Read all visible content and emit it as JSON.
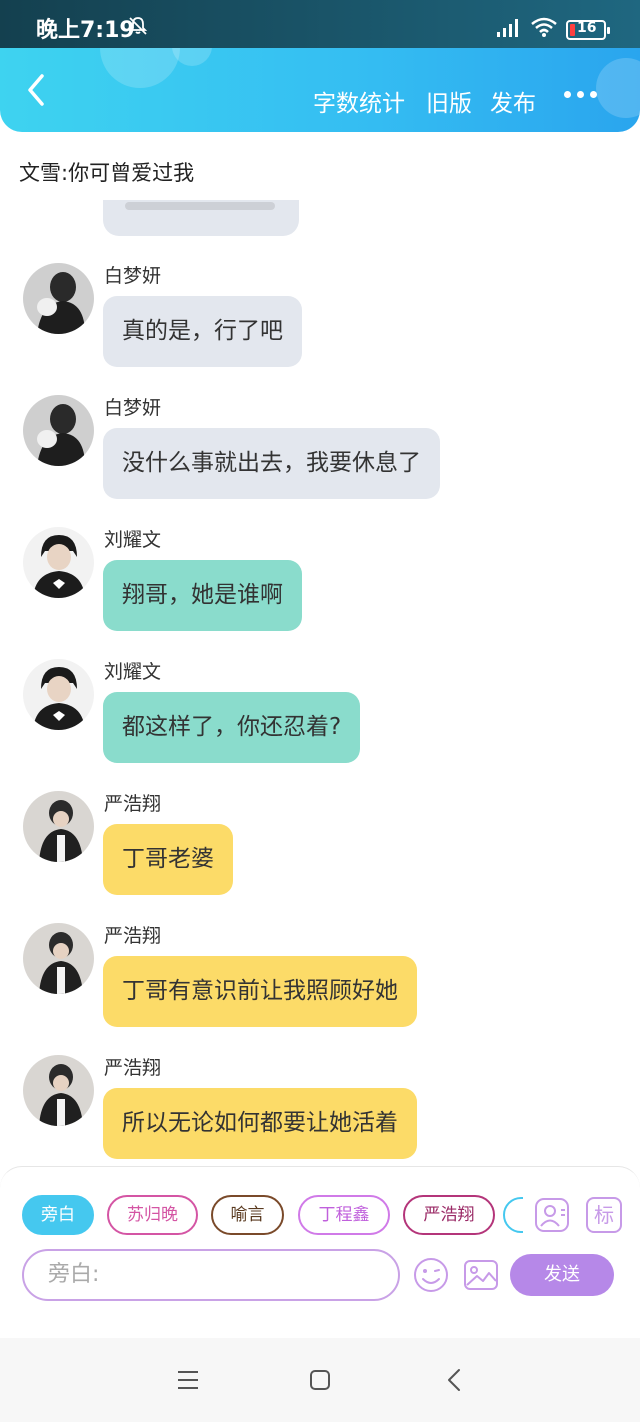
{
  "status_bar": {
    "time": "晚上7:19",
    "battery": "16",
    "icons": [
      "bell-off-icon",
      "signal-icon",
      "wifi-icon",
      "battery-icon"
    ]
  },
  "header": {
    "back_icon": "chevron-left-icon",
    "word_count": "字数统计",
    "old_version": "旧版",
    "publish": "发布",
    "more_icon": "more-dots-icon"
  },
  "subtitle": "文雪:你可曾爱过我",
  "messages": [
    {
      "sender": "白梦妍",
      "text": "真的是，行了吧",
      "style": "grey"
    },
    {
      "sender": "白梦妍",
      "text": "没什么事就出去，我要休息了",
      "style": "grey"
    },
    {
      "sender": "刘耀文",
      "text": "翔哥，她是谁啊",
      "style": "teal"
    },
    {
      "sender": "刘耀文",
      "text": "都这样了，你还忍着?",
      "style": "teal"
    },
    {
      "sender": "严浩翔",
      "text": "丁哥老婆",
      "style": "yellow"
    },
    {
      "sender": "严浩翔",
      "text": "丁哥有意识前让我照顾好她",
      "style": "yellow"
    },
    {
      "sender": "严浩翔",
      "text": "所以无论如何都要让她活着",
      "style": "yellow"
    }
  ],
  "characters": [
    "旁白",
    "苏归晚",
    "喻言",
    "丁程鑫",
    "严浩翔"
  ],
  "colors": {
    "header": "#35bef2",
    "chip_narration": "#45c8ef",
    "chip_su": "#d455a4",
    "chip_yu": "#7a4a2a",
    "chip_ding": "#d07ae8",
    "chip_yan": "#b4357a",
    "bubble_grey": "#e3e7ee",
    "bubble_teal": "#8adccc",
    "bubble_yellow": "#fcdb68",
    "send": "#b688e8"
  },
  "input": {
    "placeholder": "旁白:",
    "icons": [
      "role-icon",
      "tag-icon",
      "emoji-icon",
      "image-icon"
    ],
    "tag_label": "标"
  },
  "send": "发送",
  "nav": [
    "menu-icon",
    "home-icon",
    "back-icon"
  ]
}
